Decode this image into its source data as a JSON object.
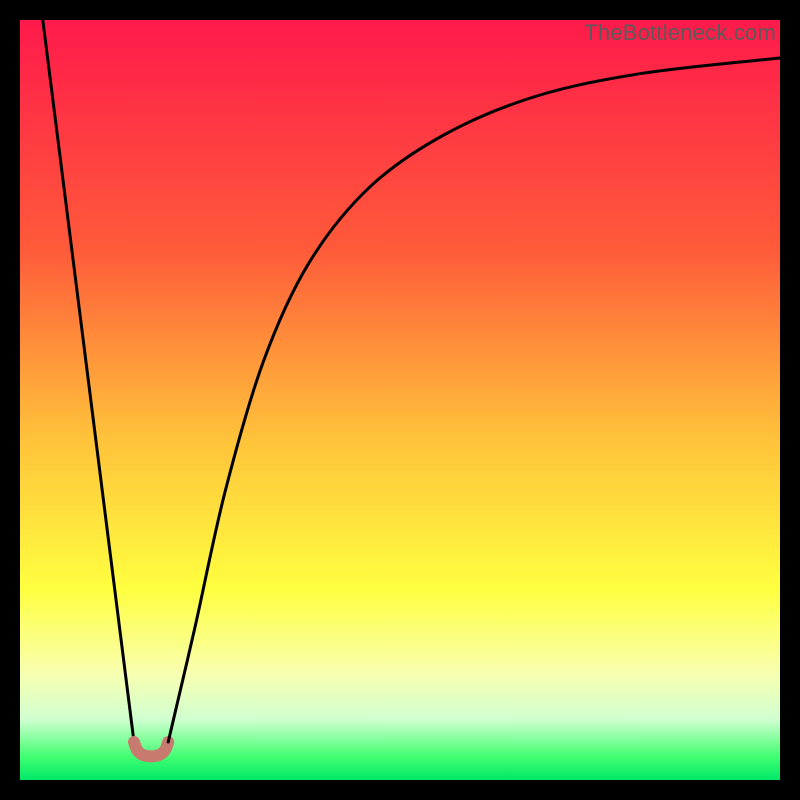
{
  "watermark": "TheBottleneck.com",
  "chart_data": {
    "type": "line",
    "title": "",
    "xlabel": "",
    "ylabel": "",
    "xlim_pct": [
      0,
      100
    ],
    "ylim_pct": [
      0,
      100
    ],
    "gradient_stops": [
      {
        "offset": 0,
        "color": "#ff1a4b"
      },
      {
        "offset": 30,
        "color": "#ff5a3a"
      },
      {
        "offset": 55,
        "color": "#ffc23a"
      },
      {
        "offset": 75,
        "color": "#ffff40"
      },
      {
        "offset": 86,
        "color": "#f8ffb0"
      },
      {
        "offset": 92,
        "color": "#d0ffd0"
      },
      {
        "offset": 97,
        "color": "#40ff70"
      },
      {
        "offset": 100,
        "color": "#00e868"
      }
    ],
    "series": [
      {
        "name": "left-arm",
        "points_pct": [
          {
            "x": 3.0,
            "y": 100.0
          },
          {
            "x": 15.0,
            "y": 5.0
          }
        ]
      },
      {
        "name": "valley-bump",
        "color": "#c97a6f",
        "points_pct": [
          {
            "x": 15.0,
            "y": 5.0
          },
          {
            "x": 15.5,
            "y": 3.8
          },
          {
            "x": 16.5,
            "y": 3.2
          },
          {
            "x": 18.0,
            "y": 3.2
          },
          {
            "x": 19.0,
            "y": 3.8
          },
          {
            "x": 19.5,
            "y": 5.0
          }
        ]
      },
      {
        "name": "right-arm",
        "points_pct": [
          {
            "x": 19.5,
            "y": 5.0
          },
          {
            "x": 23.0,
            "y": 20.0
          },
          {
            "x": 27.0,
            "y": 38.0
          },
          {
            "x": 32.0,
            "y": 55.0
          },
          {
            "x": 38.0,
            "y": 68.0
          },
          {
            "x": 46.0,
            "y": 78.0
          },
          {
            "x": 56.0,
            "y": 85.0
          },
          {
            "x": 68.0,
            "y": 90.0
          },
          {
            "x": 82.0,
            "y": 93.0
          },
          {
            "x": 100.0,
            "y": 95.0
          }
        ]
      }
    ]
  }
}
